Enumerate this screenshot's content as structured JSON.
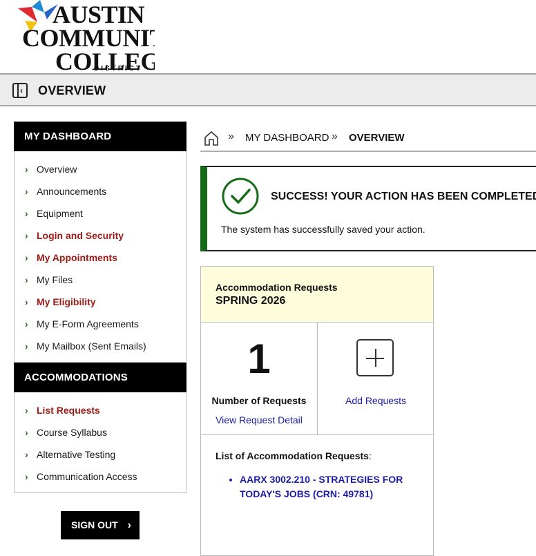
{
  "logo": {
    "line1": "AUSTIN",
    "line2": "COMMUNITY",
    "line3": "COLLEGE",
    "line4": "DISTRICT"
  },
  "topbar": {
    "title": "OVERVIEW"
  },
  "sidebar": {
    "dashboard_heading": "MY DASHBOARD",
    "dashboard_items": [
      {
        "label": "Overview"
      },
      {
        "label": "Announcements"
      },
      {
        "label": "Equipment"
      },
      {
        "label": "Login and Security"
      },
      {
        "label": "My Appointments"
      },
      {
        "label": "My Files"
      },
      {
        "label": "My Eligibility"
      },
      {
        "label": "My E-Form Agreements"
      },
      {
        "label": "My Mailbox (Sent Emails)"
      }
    ],
    "accommodations_heading": "ACCOMMODATIONS",
    "accommodations_items": [
      {
        "label": "List Requests"
      },
      {
        "label": "Course Syllabus"
      },
      {
        "label": "Alternative Testing"
      },
      {
        "label": "Communication Access"
      }
    ]
  },
  "signout": {
    "label": "SIGN OUT"
  },
  "breadcrumb": {
    "items": [
      "MY DASHBOARD",
      "OVERVIEW"
    ]
  },
  "alert": {
    "title": "SUCCESS! YOUR ACTION HAS BEEN COMPLETED",
    "message": "The system has successfully saved your action."
  },
  "card": {
    "heading": "Accommodation Requests",
    "term": "SPRING 2026",
    "count": "1",
    "count_label": "Number of Requests",
    "view_link": "View Request Detail",
    "add_label": "Add Requests",
    "list_title": "List of Accommodation Requests",
    "list_suffix": ":",
    "requests": [
      "AARX 3002.210 - STRATEGIES FOR TODAY'S JOBS (CRN: 49781)"
    ]
  },
  "colors": {
    "accent_red": "#9b1a16",
    "success_green": "#166b18",
    "link_blue": "#1c1ca8",
    "card_header": "#fdfddc"
  }
}
